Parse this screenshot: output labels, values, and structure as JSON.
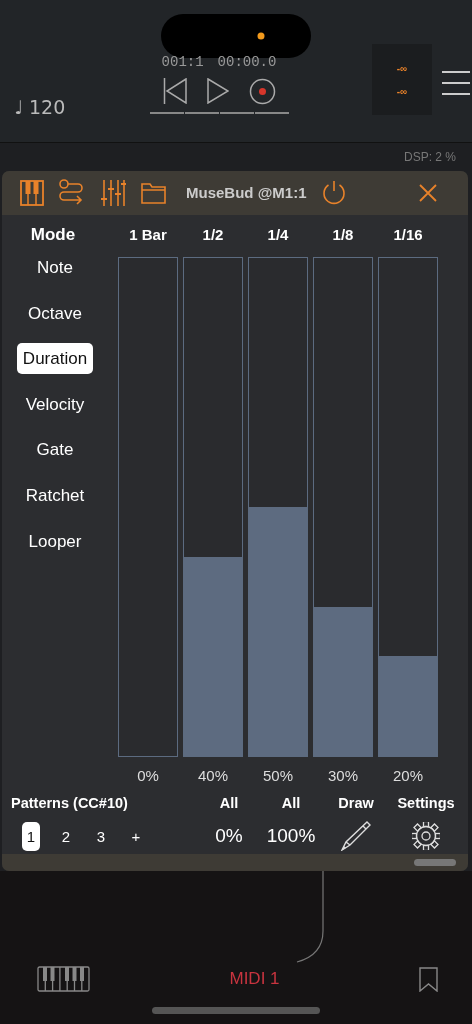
{
  "transport": {
    "tempo": "♩ 120",
    "position": "001:1",
    "time": "00:00.0"
  },
  "meter": {
    "left": "-∞",
    "right": "-∞"
  },
  "dsp": "DSP: 2 %",
  "plugin": {
    "title": "MuseBud @M1:1"
  },
  "modes": {
    "heading": "Mode",
    "items": [
      {
        "label": "Note",
        "selected": false
      },
      {
        "label": "Octave",
        "selected": false
      },
      {
        "label": "Duration",
        "selected": true
      },
      {
        "label": "Velocity",
        "selected": false
      },
      {
        "label": "Gate",
        "selected": false
      },
      {
        "label": "Ratchet",
        "selected": false
      },
      {
        "label": "Looper",
        "selected": false
      }
    ]
  },
  "steps": [
    {
      "label": "1 Bar",
      "level": 0,
      "reading": "0%"
    },
    {
      "label": "1/2",
      "level": 0.4,
      "reading": "40%"
    },
    {
      "label": "1/4",
      "level": 0.5,
      "reading": "50%"
    },
    {
      "label": "1/8",
      "level": 0.3,
      "reading": "30%"
    },
    {
      "label": "1/16",
      "level": 0.2,
      "reading": "20%"
    }
  ],
  "patterns": {
    "heading": "Patterns (CC#10)",
    "items": [
      {
        "label": "1",
        "selected": true
      },
      {
        "label": "2",
        "selected": false
      },
      {
        "label": "3",
        "selected": false
      }
    ],
    "add": "+"
  },
  "controls": [
    {
      "kind": "value",
      "label": "All",
      "value": "0%"
    },
    {
      "kind": "value",
      "label": "All",
      "value": "100%"
    },
    {
      "kind": "draw",
      "label": "Draw"
    },
    {
      "kind": "settings",
      "label": "Settings"
    }
  ],
  "bottom_bar": {
    "track": "MIDI 1"
  }
}
